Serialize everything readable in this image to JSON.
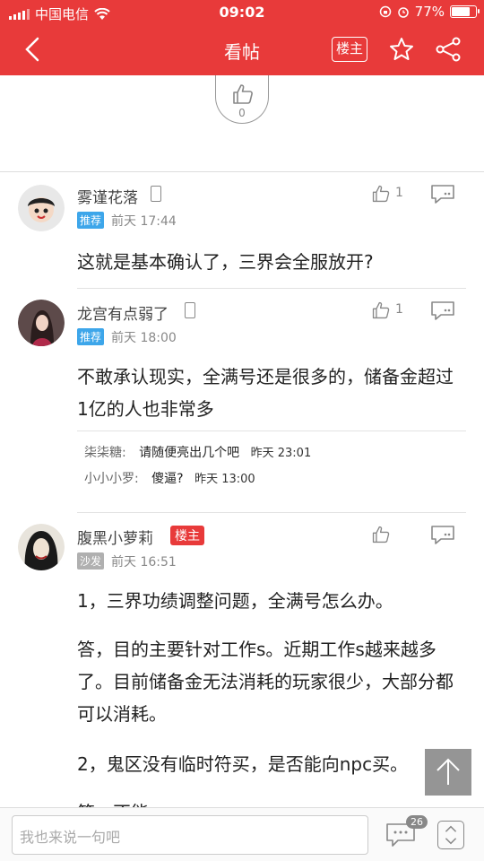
{
  "status": {
    "carrier": "中国电信",
    "time": "09:02",
    "battery": "77%",
    "battery_level": 0.77
  },
  "header": {
    "title": "看帖",
    "louzhu_label": "楼主"
  },
  "post_like": {
    "count": "0"
  },
  "comments": [
    {
      "username": "雾谨花落",
      "tag": "推荐",
      "time": "前天 17:44",
      "likes": "1",
      "text": "这就是基本确认了，三界会全服放开?"
    },
    {
      "username": "龙宫有点弱了",
      "tag": "推荐",
      "time": "前天 18:00",
      "likes": "1",
      "text": "不敢承认现实，全满号还是很多的，储备金超过1亿的人也非常多",
      "replies": [
        {
          "name": "柒柒糖:",
          "text": "请随便亮出几个吧",
          "time": "昨天 23:01"
        },
        {
          "name": "小小小罗:",
          "text": "傻逼?",
          "time": "昨天 13:00"
        }
      ]
    },
    {
      "username": "腹黑小萝莉",
      "louzhu": "楼主",
      "tag": "沙发",
      "time": "前天 16:51",
      "paragraphs": [
        "1，三界功绩调整问题，全满号怎么办。",
        "答，目的主要针对工作s。近期工作s越来越多了。目前储备金无法消耗的玩家很少，大部分都可以消耗。",
        "2，鬼区没有临时符买，是否能向npc买。",
        "答，不能。"
      ]
    }
  ],
  "bottom": {
    "placeholder": "我也来说一句吧",
    "comment_count": "26"
  }
}
